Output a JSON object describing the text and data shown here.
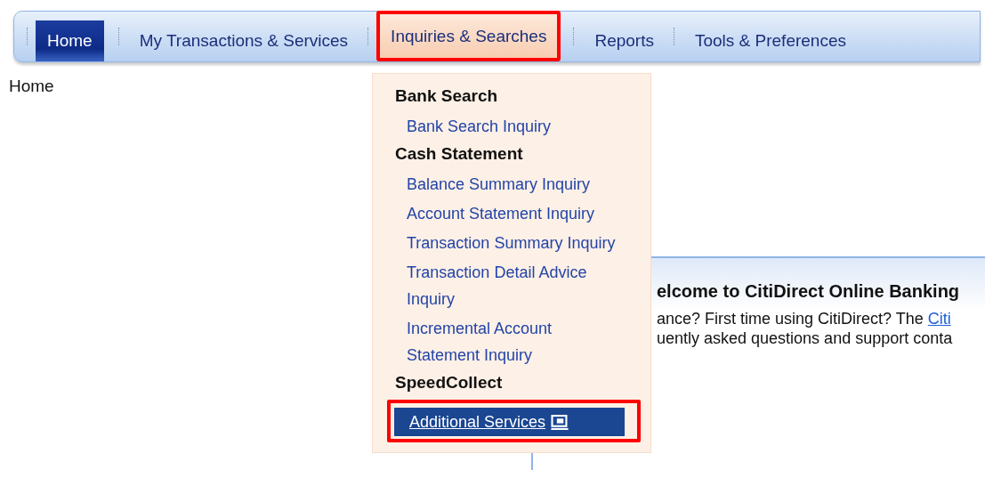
{
  "nav": {
    "tabs": [
      {
        "label": "Home",
        "selected": true,
        "highlighted": false
      },
      {
        "label": "My Transactions & Services",
        "selected": false,
        "highlighted": false
      },
      {
        "label": "Inquiries & Searches",
        "selected": false,
        "highlighted": true,
        "open": true
      },
      {
        "label": "Reports",
        "selected": false,
        "highlighted": false
      },
      {
        "label": "Tools & Preferences",
        "selected": false,
        "highlighted": false
      }
    ]
  },
  "breadcrumb": "Home",
  "dropdown": {
    "items": [
      {
        "kind": "heading",
        "label": "Bank Search"
      },
      {
        "kind": "link",
        "label": "Bank Search Inquiry",
        "selected": false,
        "highlighted": false
      },
      {
        "kind": "heading",
        "label": "Cash Statement"
      },
      {
        "kind": "link",
        "label": "Balance Summary Inquiry",
        "selected": false,
        "highlighted": false
      },
      {
        "kind": "link",
        "label": "Account Statement Inquiry",
        "selected": false,
        "highlighted": false
      },
      {
        "kind": "link",
        "label": "Transaction Summary Inquiry",
        "selected": false,
        "highlighted": false
      },
      {
        "kind": "link",
        "label": "Transaction Detail Advice Inquiry",
        "selected": false,
        "highlighted": false
      },
      {
        "kind": "link",
        "label": "Incremental Account Statement Inquiry",
        "selected": false,
        "highlighted": false
      },
      {
        "kind": "heading",
        "label": "SpeedCollect"
      },
      {
        "kind": "link",
        "label": "Additional Services",
        "selected": true,
        "highlighted": true,
        "external": true
      }
    ]
  },
  "welcome": {
    "title": "elcome to CitiDirect Online Banking",
    "line_1": "ance? First time using CitiDirect? The ",
    "line_1_link": "Citi",
    "line_2": "uently asked questions and support conta"
  }
}
